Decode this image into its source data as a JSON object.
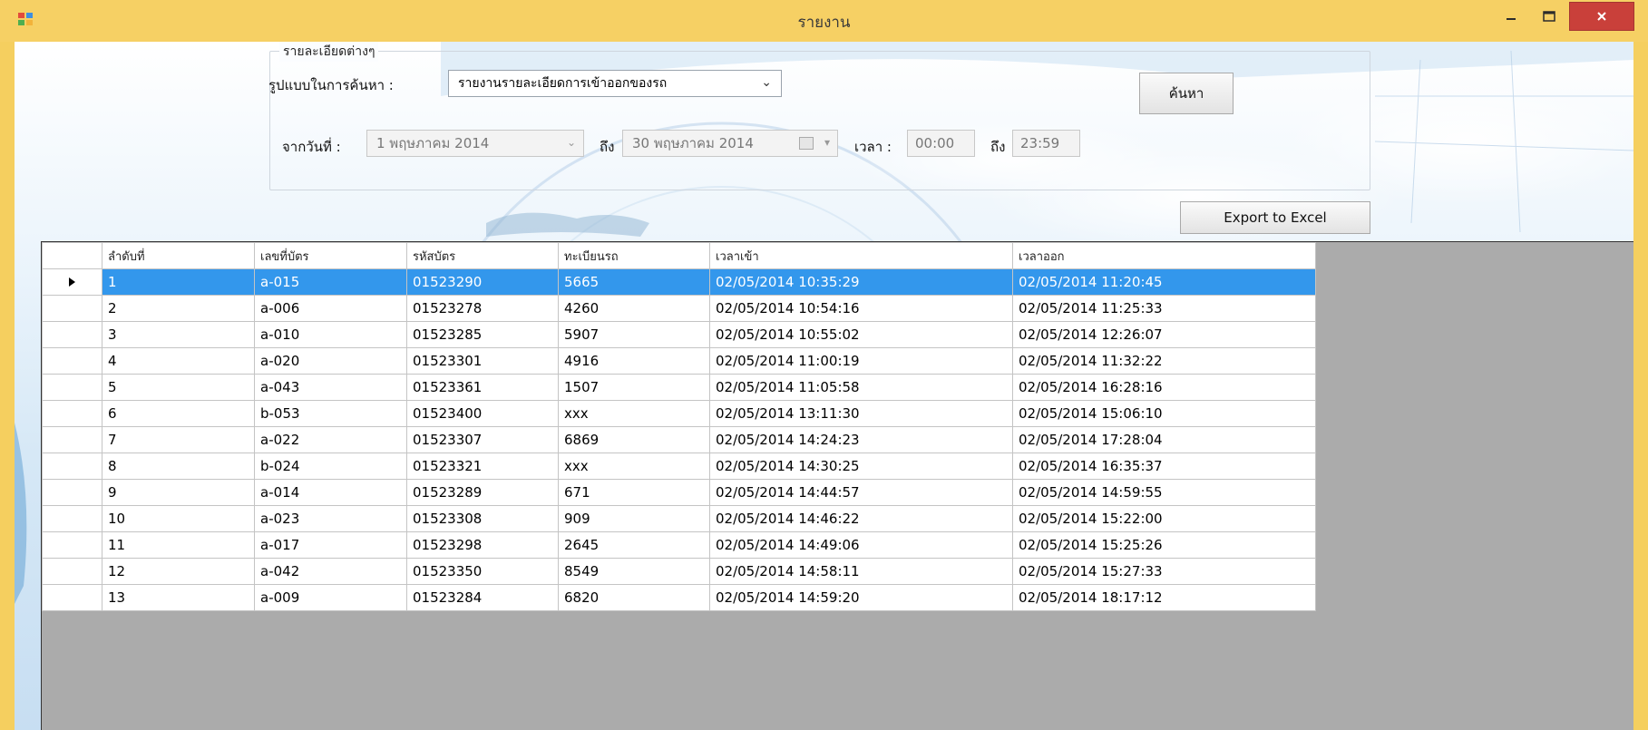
{
  "window": {
    "title": "รายงาน"
  },
  "filters": {
    "group_label": "รายละเอียดต่างๆ",
    "search_format_label": "รูปแบบในการค้นหา :",
    "search_format_value": "รายงานรายละเอียดการเข้าออกของรถ",
    "from_date_label": "จากวันที่ :",
    "from_date_value": "1  พฤษภาคม  2014",
    "to_label": "ถึง",
    "to_date_value": "30  พฤษภาคม  2014",
    "time_label": "เวลา :",
    "time_from_value": "00:00",
    "time_to_label": "ถึง",
    "time_to_value": "23:59",
    "search_button": "ค้นหา",
    "export_button": "Export to Excel"
  },
  "table": {
    "columns": [
      "ลำดับที่",
      "เลขที่บัตร",
      "รหัสบัตร",
      "ทะเบียนรถ",
      "เวลาเข้า",
      "เวลาออก"
    ],
    "rows": [
      [
        "1",
        "a-015",
        "01523290",
        "5665",
        "02/05/2014  10:35:29",
        "02/05/2014  11:20:45"
      ],
      [
        "2",
        "a-006",
        "01523278",
        "4260",
        "02/05/2014  10:54:16",
        "02/05/2014  11:25:33"
      ],
      [
        "3",
        "a-010",
        "01523285",
        "5907",
        "02/05/2014  10:55:02",
        "02/05/2014  12:26:07"
      ],
      [
        "4",
        "a-020",
        "01523301",
        "4916",
        "02/05/2014  11:00:19",
        "02/05/2014  11:32:22"
      ],
      [
        "5",
        "a-043",
        "01523361",
        "1507",
        "02/05/2014  11:05:58",
        "02/05/2014  16:28:16"
      ],
      [
        "6",
        "b-053",
        "01523400",
        "xxx",
        "02/05/2014  13:11:30",
        "02/05/2014  15:06:10"
      ],
      [
        "7",
        "a-022",
        "01523307",
        "6869",
        "02/05/2014  14:24:23",
        "02/05/2014  17:28:04"
      ],
      [
        "8",
        "b-024",
        "01523321",
        "xxx",
        "02/05/2014  14:30:25",
        "02/05/2014  16:35:37"
      ],
      [
        "9",
        "a-014",
        "01523289",
        "671",
        "02/05/2014  14:44:57",
        "02/05/2014  14:59:55"
      ],
      [
        "10",
        "a-023",
        "01523308",
        "909",
        "02/05/2014  14:46:22",
        "02/05/2014  15:22:00"
      ],
      [
        "11",
        "a-017",
        "01523298",
        "2645",
        "02/05/2014  14:49:06",
        "02/05/2014  15:25:26"
      ],
      [
        "12",
        "a-042",
        "01523350",
        "8549",
        "02/05/2014  14:58:11",
        "02/05/2014  15:27:33"
      ],
      [
        "13",
        "a-009",
        "01523284",
        "6820",
        "02/05/2014  14:59:20",
        "02/05/2014  18:17:12"
      ]
    ],
    "selected_row": 0
  },
  "colors": {
    "titlebar": "#f6d064",
    "close": "#c9403a",
    "selection": "#3397ec",
    "grid_bg": "#ababab"
  },
  "icons": {
    "app": "app-icon",
    "minimize": "minimize-icon",
    "maximize": "maximize-icon",
    "close": "close-icon",
    "dropdown": "chevron-down-icon",
    "row_indicator": "row-indicator-icon"
  }
}
